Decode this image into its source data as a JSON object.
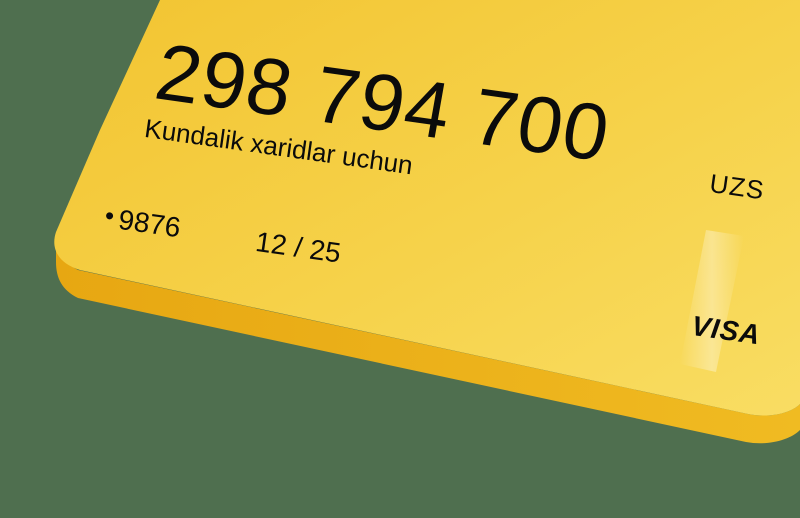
{
  "card": {
    "amount": "298 794 700",
    "currency": "UZS",
    "subtitle": "Kundalik xaridlar uchun",
    "masked_number": "9876",
    "expiry": "12 / 25",
    "brand": "VISA"
  },
  "colors": {
    "background": "#4f6f4f",
    "card_face": "#f5cf3e",
    "card_edge": "#e9ab16",
    "text": "#0b0b0b"
  }
}
